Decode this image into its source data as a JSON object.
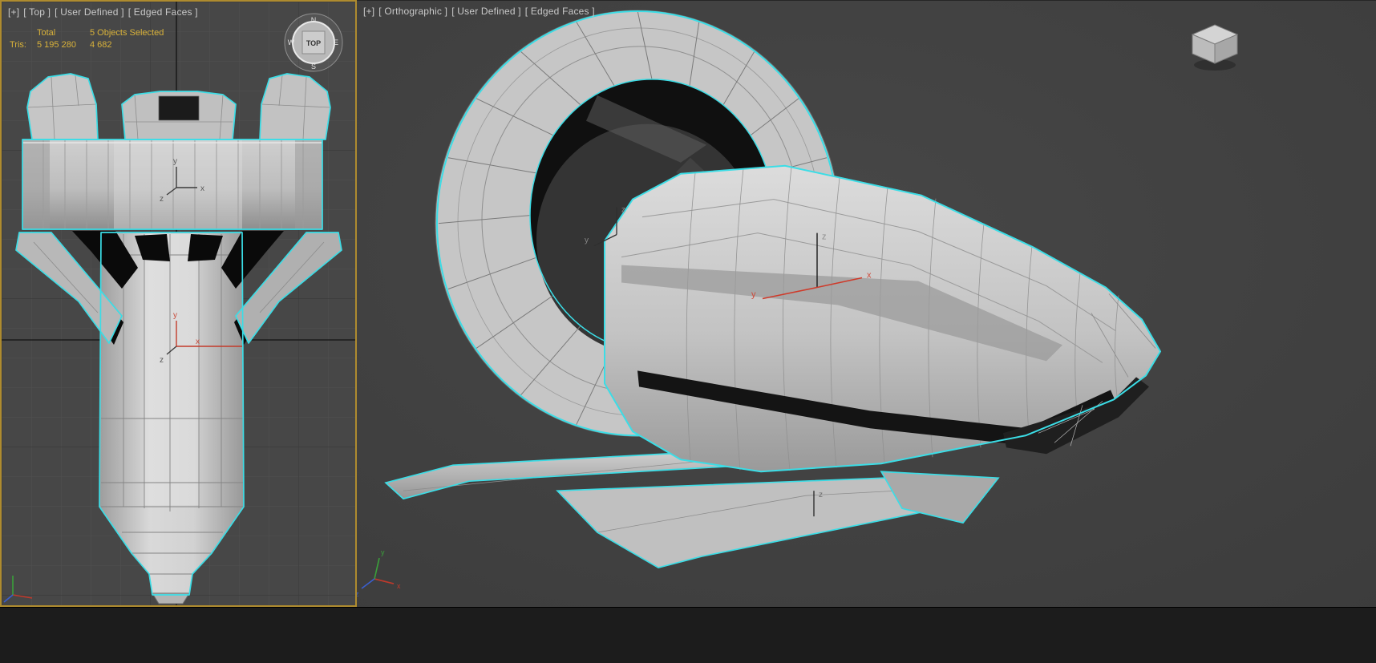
{
  "left_viewport": {
    "label": {
      "plus": "[+]",
      "view": "[ Top ]",
      "style": "[ User Defined ]",
      "mode": "[ Edged Faces ]"
    },
    "stats": {
      "total_label": "Total",
      "objects_selected": "5 Objects Selected",
      "tris_label": "Tris:",
      "tris_total": "5 195 280",
      "tris_selected": "4 682"
    },
    "viewcube": {
      "face": "TOP",
      "n": "N",
      "e": "E",
      "s": "S",
      "w": "W"
    }
  },
  "right_viewport": {
    "label": {
      "plus": "[+]",
      "view": "[ Orthographic ]",
      "style": "[ User Defined ]",
      "mode": "[ Edged Faces ]"
    }
  },
  "axes": {
    "x": "x",
    "y": "y",
    "z": "z"
  },
  "colors": {
    "selection": "#3bdde6",
    "active_viewport_border": "#ae8b2f",
    "stats_text": "#d9b23a",
    "label_text": "#c9c9c9"
  }
}
